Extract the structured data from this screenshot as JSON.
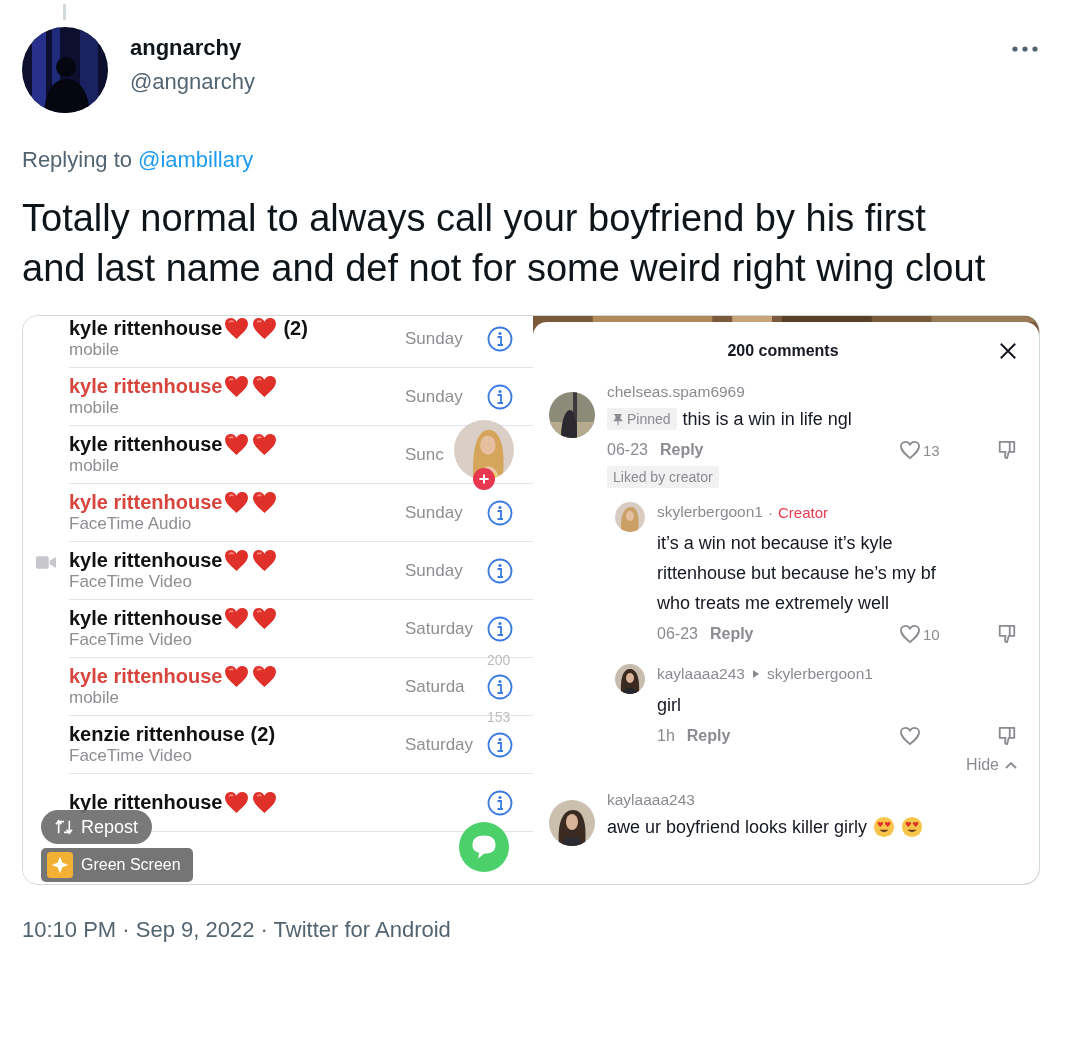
{
  "tweet": {
    "author": {
      "name": "angnarchy",
      "handle": "@angnarchy"
    },
    "replying_to": {
      "label": "Replying to",
      "handle": "@iambillary"
    },
    "text": "Totally normal to always call your boyfriend by his first and last name and def not for some weird right wing clout",
    "attachment": {
      "call_log": {
        "rows": [
          {
            "name": "kyle rittenhouse",
            "emoji_hearts": true,
            "count": "(2)",
            "missed": false,
            "call_type": "mobile",
            "date": "Sunday",
            "video_icon": false
          },
          {
            "name": "kyle rittenhouse",
            "emoji_hearts": true,
            "missed": true,
            "call_type": "mobile",
            "date": "Sunday",
            "video_icon": false
          },
          {
            "name": "kyle rittenhouse",
            "emoji_hearts": true,
            "missed": false,
            "call_type": "mobile",
            "date": "Sunc",
            "video_icon": false,
            "info_icon": false
          },
          {
            "name": "kyle rittenhouse",
            "emoji_hearts": true,
            "missed": true,
            "call_type": "FaceTime Audio",
            "date": "Sunday",
            "video_icon": false
          },
          {
            "name": "kyle rittenhouse",
            "emoji_hearts": true,
            "missed": false,
            "call_type": "FaceTime Video",
            "date": "Sunday",
            "video_icon": true
          },
          {
            "name": "kyle rittenhouse",
            "emoji_hearts": true,
            "missed": false,
            "call_type": "FaceTime Video",
            "date": "Saturday",
            "video_icon": false
          },
          {
            "name": "kyle rittenhouse",
            "emoji_hearts": true,
            "missed": true,
            "call_type": "mobile",
            "date": "Saturda",
            "video_icon": false
          },
          {
            "name": "kenzie rittenhouse",
            "emoji_hearts": false,
            "count": "(2)",
            "missed": false,
            "call_type": "FaceTime Video",
            "date": "Saturday",
            "video_icon": false
          },
          {
            "name": "kyle rittenhouse",
            "emoji_hearts": true,
            "missed": false,
            "video_icon": false
          }
        ]
      },
      "video_overlay": {
        "comment_count": "200",
        "save_count": "153",
        "repost": "Repost",
        "effect": "Green Screen"
      },
      "comments_panel": {
        "title": "200 comments",
        "comments": [
          {
            "user": "chelseas.spam6969",
            "pinned": "Pinned",
            "text": "this is a win in life ngl",
            "date": "06-23",
            "reply": "Reply",
            "likes": "13",
            "liked_by_creator": "Liked by creator",
            "hide": "Hide",
            "children": [
              {
                "user": "skylerbergoon1",
                "separator": "·",
                "badge": "Creator",
                "text": "it’s a win not because it’s kyle rittenhouse but because he’s my bf who treats me extremely well",
                "date": "06-23",
                "reply": "Reply",
                "likes": "10"
              },
              {
                "user": "kaylaaaa243",
                "reply_to": "skylerbergoon1",
                "text": "girl",
                "date": "1h",
                "reply": "Reply"
              }
            ]
          },
          {
            "user": "kaylaaaa243",
            "text": "awe ur boyfriend looks killer girly",
            "emoji": true
          }
        ]
      }
    },
    "timestamp": "10:10 PM · Sep 9, 2022 · Twitter for Android"
  }
}
